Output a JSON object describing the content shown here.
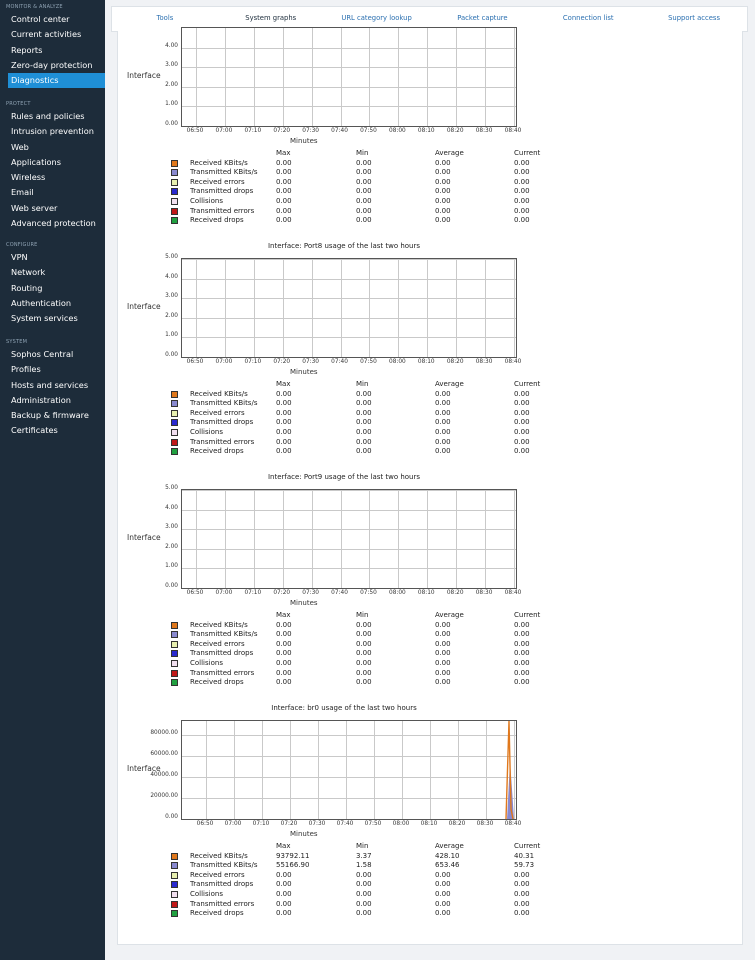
{
  "sidebar": {
    "sections": [
      {
        "label": "MONITOR & ANALYZE",
        "items": [
          "Control center",
          "Current activities",
          "Reports",
          "Zero-day protection",
          "Diagnostics"
        ]
      },
      {
        "label": "PROTECT",
        "items": [
          "Rules and policies",
          "Intrusion prevention",
          "Web",
          "Applications",
          "Wireless",
          "Email",
          "Web server",
          "Advanced protection"
        ]
      },
      {
        "label": "CONFIGURE",
        "items": [
          "VPN",
          "Network",
          "Routing",
          "Authentication",
          "System services"
        ]
      },
      {
        "label": "SYSTEM",
        "items": [
          "Sophos Central",
          "Profiles",
          "Hosts and services",
          "Administration",
          "Backup & firmware",
          "Certificates"
        ]
      }
    ],
    "active_item": "Diagnostics"
  },
  "tabs": [
    "Tools",
    "System graphs",
    "URL category lookup",
    "Packet capture",
    "Connection list",
    "Support access"
  ],
  "active_tab": "System graphs",
  "interface_label": "Interface",
  "x_axis_label": "Minutes",
  "x_ticks": [
    "06:50",
    "07:00",
    "07:10",
    "07:20",
    "07:30",
    "07:40",
    "07:50",
    "08:00",
    "08:10",
    "08:20",
    "08:30",
    "08:40"
  ],
  "stats_headers": [
    "Max",
    "Min",
    "Average",
    "Current"
  ],
  "legend_colors": [
    "#e0781c",
    "#8a8ad0",
    "#e8f0b0",
    "#2a2ad0",
    "#f2e0f0",
    "#c01818",
    "#20a040"
  ],
  "chart_data": [
    {
      "type": "area",
      "title": "",
      "xlabel": "Minutes",
      "ylabel": "",
      "ylim": [
        0,
        5
      ],
      "y_ticks": [
        "0.00",
        "1.00",
        "2.00",
        "3.00",
        "4.00"
      ],
      "x": [
        "06:50",
        "07:00",
        "07:10",
        "07:20",
        "07:30",
        "07:40",
        "07:50",
        "08:00",
        "08:10",
        "08:20",
        "08:30",
        "08:40"
      ],
      "series": [
        {
          "name": "Received KBits/s",
          "max": "0.00",
          "min": "0.00",
          "average": "0.00",
          "current": "0.00"
        },
        {
          "name": "Transmitted KBits/s",
          "max": "0.00",
          "min": "0.00",
          "average": "0.00",
          "current": "0.00"
        },
        {
          "name": "Received errors",
          "max": "0.00",
          "min": "0.00",
          "average": "0.00",
          "current": "0.00"
        },
        {
          "name": "Transmitted drops",
          "max": "0.00",
          "min": "0.00",
          "average": "0.00",
          "current": "0.00"
        },
        {
          "name": "Collisions",
          "max": "0.00",
          "min": "0.00",
          "average": "0.00",
          "current": "0.00"
        },
        {
          "name": "Transmitted errors",
          "max": "0.00",
          "min": "0.00",
          "average": "0.00",
          "current": "0.00"
        },
        {
          "name": "Received drops",
          "max": "0.00",
          "min": "0.00",
          "average": "0.00",
          "current": "0.00"
        }
      ]
    },
    {
      "type": "area",
      "title": "Interface: Port8 usage of the last two hours",
      "xlabel": "Minutes",
      "ylabel": "",
      "ylim": [
        0,
        5
      ],
      "y_ticks": [
        "0.00",
        "1.00",
        "2.00",
        "3.00",
        "4.00",
        "5.00"
      ],
      "x": [
        "06:50",
        "07:00",
        "07:10",
        "07:20",
        "07:30",
        "07:40",
        "07:50",
        "08:00",
        "08:10",
        "08:20",
        "08:30",
        "08:40"
      ],
      "series": [
        {
          "name": "Received KBits/s",
          "max": "0.00",
          "min": "0.00",
          "average": "0.00",
          "current": "0.00"
        },
        {
          "name": "Transmitted KBits/s",
          "max": "0.00",
          "min": "0.00",
          "average": "0.00",
          "current": "0.00"
        },
        {
          "name": "Received errors",
          "max": "0.00",
          "min": "0.00",
          "average": "0.00",
          "current": "0.00"
        },
        {
          "name": "Transmitted drops",
          "max": "0.00",
          "min": "0.00",
          "average": "0.00",
          "current": "0.00"
        },
        {
          "name": "Collisions",
          "max": "0.00",
          "min": "0.00",
          "average": "0.00",
          "current": "0.00"
        },
        {
          "name": "Transmitted errors",
          "max": "0.00",
          "min": "0.00",
          "average": "0.00",
          "current": "0.00"
        },
        {
          "name": "Received drops",
          "max": "0.00",
          "min": "0.00",
          "average": "0.00",
          "current": "0.00"
        }
      ]
    },
    {
      "type": "area",
      "title": "Interface: Port9 usage of the last two hours",
      "xlabel": "Minutes",
      "ylabel": "",
      "ylim": [
        0,
        5
      ],
      "y_ticks": [
        "0.00",
        "1.00",
        "2.00",
        "3.00",
        "4.00",
        "5.00"
      ],
      "x": [
        "06:50",
        "07:00",
        "07:10",
        "07:20",
        "07:30",
        "07:40",
        "07:50",
        "08:00",
        "08:10",
        "08:20",
        "08:30",
        "08:40"
      ],
      "series": [
        {
          "name": "Received KBits/s",
          "max": "0.00",
          "min": "0.00",
          "average": "0.00",
          "current": "0.00"
        },
        {
          "name": "Transmitted KBits/s",
          "max": "0.00",
          "min": "0.00",
          "average": "0.00",
          "current": "0.00"
        },
        {
          "name": "Received errors",
          "max": "0.00",
          "min": "0.00",
          "average": "0.00",
          "current": "0.00"
        },
        {
          "name": "Transmitted drops",
          "max": "0.00",
          "min": "0.00",
          "average": "0.00",
          "current": "0.00"
        },
        {
          "name": "Collisions",
          "max": "0.00",
          "min": "0.00",
          "average": "0.00",
          "current": "0.00"
        },
        {
          "name": "Transmitted errors",
          "max": "0.00",
          "min": "0.00",
          "average": "0.00",
          "current": "0.00"
        },
        {
          "name": "Received drops",
          "max": "0.00",
          "min": "0.00",
          "average": "0.00",
          "current": "0.00"
        }
      ]
    },
    {
      "type": "area",
      "title": "Interface: br0 usage of the last two hours",
      "xlabel": "Minutes",
      "ylabel": "",
      "ylim": [
        0,
        93792
      ],
      "y_ticks": [
        "0.00",
        "20000.00",
        "40000.00",
        "60000.00",
        "80000.00"
      ],
      "x": [
        "06:50",
        "07:00",
        "07:10",
        "07:20",
        "07:30",
        "07:40",
        "07:50",
        "08:00",
        "08:10",
        "08:20",
        "08:30",
        "08:40"
      ],
      "series": [
        {
          "name": "Received KBits/s",
          "max": "93792.11",
          "min": "3.37",
          "average": "428.10",
          "current": "40.31"
        },
        {
          "name": "Transmitted KBits/s",
          "max": "55166.90",
          "min": "1.58",
          "average": "653.46",
          "current": "59.73"
        },
        {
          "name": "Received errors",
          "max": "0.00",
          "min": "0.00",
          "average": "0.00",
          "current": "0.00"
        },
        {
          "name": "Transmitted drops",
          "max": "0.00",
          "min": "0.00",
          "average": "0.00",
          "current": "0.00"
        },
        {
          "name": "Collisions",
          "max": "0.00",
          "min": "0.00",
          "average": "0.00",
          "current": "0.00"
        },
        {
          "name": "Transmitted errors",
          "max": "0.00",
          "min": "0.00",
          "average": "0.00",
          "current": "0.00"
        },
        {
          "name": "Received drops",
          "max": "0.00",
          "min": "0.00",
          "average": "0.00",
          "current": "0.00"
        }
      ]
    }
  ]
}
